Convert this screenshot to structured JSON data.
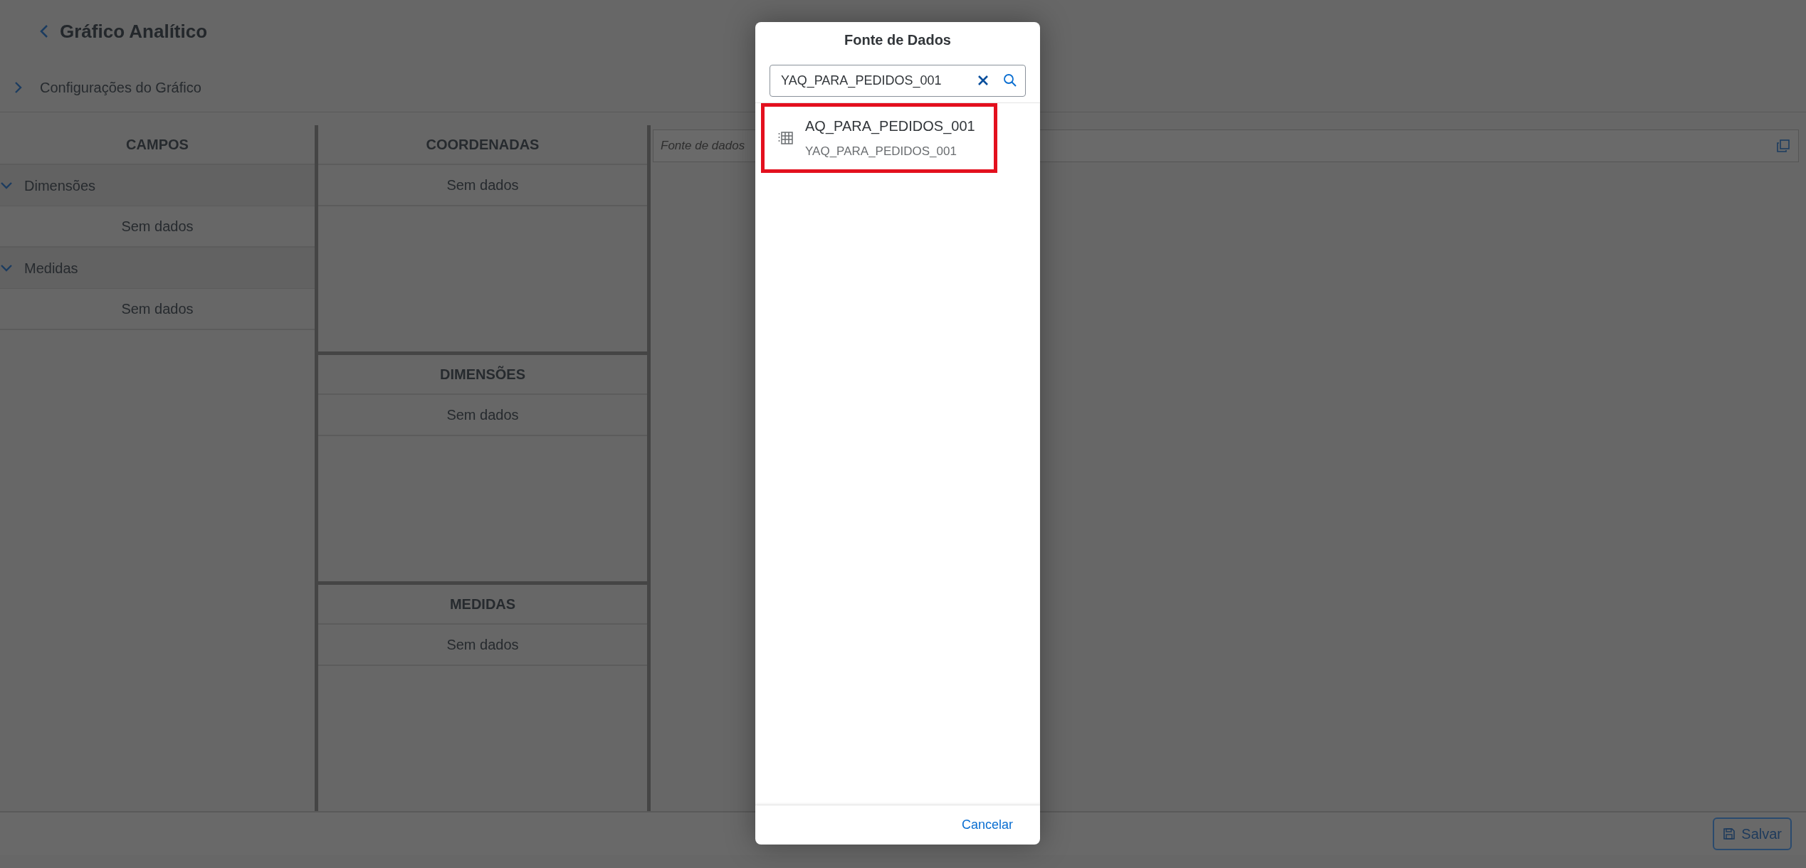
{
  "page": {
    "title": "Gráfico Analítico",
    "settings_section": {
      "label": "Configurações do Gráfico",
      "expanded": false
    }
  },
  "fields_panel": {
    "heading": "CAMPOS",
    "groups": [
      {
        "label": "Dimensões",
        "expanded": true,
        "empty_text": "Sem dados"
      },
      {
        "label": "Medidas",
        "expanded": true,
        "empty_text": "Sem dados"
      }
    ]
  },
  "drop_zones": [
    {
      "heading": "COORDENADAS",
      "empty_text": "Sem dados"
    },
    {
      "heading": "DIMENSÕES",
      "empty_text": "Sem dados"
    },
    {
      "heading": "MEDIDAS",
      "empty_text": "Sem dados"
    }
  ],
  "data_source_field": {
    "placeholder": "Fonte de dados"
  },
  "footer": {
    "save_button": "Salvar"
  },
  "dialog": {
    "title": "Fonte de Dados",
    "search": {
      "value": "YAQ_PARA_PEDIDOS_001"
    },
    "results": [
      {
        "title": "AQ_PARA_PEDIDOS_001",
        "subtitle": "YAQ_PARA_PEDIDOS_001",
        "highlighted": true
      }
    ],
    "cancel_button": "Cancelar"
  }
}
